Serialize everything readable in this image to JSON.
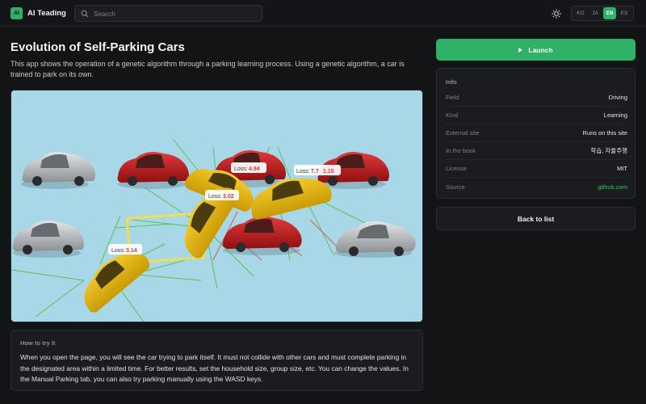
{
  "header": {
    "logo_badge": "AI",
    "logo_text": "AI Teading",
    "search_placeholder": "Search",
    "languages": [
      {
        "label": "KO",
        "active": false
      },
      {
        "label": "JA",
        "active": false
      },
      {
        "label": "EN",
        "active": true
      },
      {
        "label": "ES",
        "active": false
      }
    ]
  },
  "main": {
    "title": "Evolution of Self-Parking Cars",
    "description": "This app shows the operation of a genetic algorithm through a parking learning process. Using a genetic algorithm, a car is trained to park on its own.",
    "canvas": {
      "loss_labels": [
        {
          "prefix": "Loss:",
          "value": "4.94"
        },
        {
          "prefix": "Loss:",
          "value": "7.7"
        },
        {
          "prefix": "",
          "value": "1.15"
        },
        {
          "prefix": "Loss:",
          "value": "3.02"
        },
        {
          "prefix": "Loss:",
          "value": "3.14"
        }
      ]
    },
    "howto": {
      "title": "How to try it",
      "text": "When you open the page, you will see the car trying to park itself. It must not collide with other cars and must complete parking in the designated area within a limited time. For better results, set the household size, group size, etc. You can change the values. In the Manual Parking tab, you can also try parking manually using the WASD keys."
    }
  },
  "sidebar": {
    "launch_label": "Launch",
    "info_title": "Info",
    "info_rows": [
      {
        "key": "Field",
        "value": "Driving"
      },
      {
        "key": "Kind",
        "value": "Learning"
      },
      {
        "key": "External site",
        "value": "Runs on this site"
      },
      {
        "key": "In the book",
        "value": "학습, 자율주행"
      },
      {
        "key": "License",
        "value": "MIT"
      },
      {
        "key": "Source",
        "value": "github.com"
      }
    ],
    "back_label": "Back to list"
  },
  "colors": {
    "accent": "#2fb267",
    "background": "#131416",
    "card": "#1a1c1f",
    "link": "#34c274",
    "loss_value": "#e0303a"
  }
}
